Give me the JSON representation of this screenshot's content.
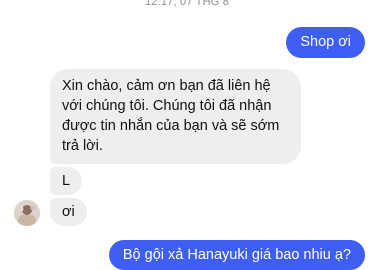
{
  "header": {
    "timestamp": "12:17, 07 THG 8"
  },
  "messages": [
    {
      "sender": "me",
      "text": "Shop ơi"
    },
    {
      "sender": "shop",
      "text": "Xin chào, cảm ơn bạn đã liên hệ với chúng tôi. Chúng tôi đã nhận được tin nhắn của bạn và sẽ sớm trả lời."
    },
    {
      "sender": "me",
      "text": "L"
    },
    {
      "sender": "me",
      "text": "ơi"
    },
    {
      "sender": "me",
      "text": "Bộ gội xả Hanayuki giá bao nhiu ạ?"
    }
  ],
  "colors": {
    "outgoing_bubble": "#3f5ef5",
    "incoming_bubble": "#eeeef0",
    "timestamp_text": "#8e8e93"
  }
}
